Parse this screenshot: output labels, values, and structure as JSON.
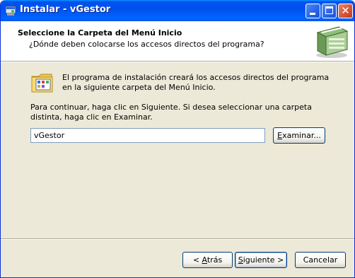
{
  "window": {
    "title": "Instalar - vGestor",
    "title_icon": "installer-icon",
    "controls": {
      "minimize": "minimize-icon",
      "maximize": "maximize-icon",
      "close": "close-icon"
    }
  },
  "header": {
    "title": "Seleccione la Carpeta del Menú Inicio",
    "subtitle": "¿Dónde deben colocarse los accesos directos del programa?",
    "image": "wizard-box-image"
  },
  "body": {
    "info": "El programa de instalación creará los accesos directos del programa en la siguiente carpeta del Menú Inicio.",
    "instructions": "Para continuar, haga clic en Siguiente. Si desea seleccionar una carpeta distinta, haga clic en Examinar.",
    "folder_value": "vGestor",
    "folder_icon": "start-menu-folder-icon"
  },
  "buttons": {
    "browse": {
      "accel": "E",
      "rest": "xaminar..."
    },
    "back": {
      "pre": "< ",
      "accel": "A",
      "rest": "trás"
    },
    "next": {
      "accel": "S",
      "rest": "iguiente >"
    },
    "cancel": "Cancelar"
  }
}
